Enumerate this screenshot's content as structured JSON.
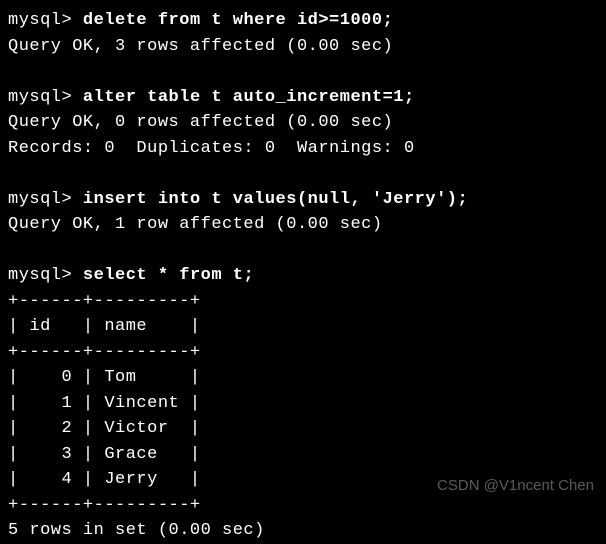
{
  "prompt": "mysql>",
  "commands": {
    "cmd1": "delete from t where id>=1000;",
    "cmd2": "alter table t auto_increment=1;",
    "cmd3": "insert into t values(null, 'Jerry');",
    "cmd4": "select * from t;"
  },
  "results": {
    "ok3rows": "Query OK, 3 rows affected (0.00 sec)",
    "ok0rows": "Query OK, 0 rows affected (0.00 sec)",
    "records": "Records: 0  Duplicates: 0  Warnings: 0",
    "ok1row": "Query OK, 1 row affected (0.00 sec)",
    "setcount": "5 rows in set (0.00 sec)"
  },
  "table": {
    "border_top": "+------+---------+",
    "header": "| id   | name    |",
    "border_mid": "+------+---------+",
    "rows": [
      "|    0 | Tom     |",
      "|    1 | Vincent |",
      "|    2 | Victor  |",
      "|    3 | Grace   |",
      "|    4 | Jerry   |"
    ],
    "border_bot": "+------+---------+"
  },
  "table_data": {
    "columns": [
      "id",
      "name"
    ],
    "rows": [
      {
        "id": 0,
        "name": "Tom"
      },
      {
        "id": 1,
        "name": "Vincent"
      },
      {
        "id": 2,
        "name": "Victor"
      },
      {
        "id": 3,
        "name": "Grace"
      },
      {
        "id": 4,
        "name": "Jerry"
      }
    ]
  },
  "watermark": "CSDN @V1ncent Chen"
}
